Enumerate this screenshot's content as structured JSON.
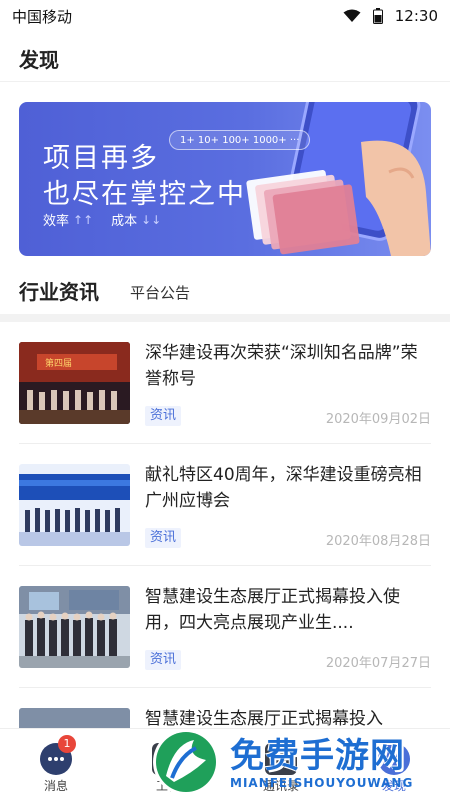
{
  "status_bar": {
    "carrier": "中国移动",
    "time": "12:30",
    "icons": [
      "wifi-icon",
      "battery-icon"
    ]
  },
  "header": {
    "title": "发现"
  },
  "banner": {
    "line1": "项目再多",
    "line2": "也尽在掌控之中",
    "metric_efficiency": "效率",
    "metric_cost": "成本",
    "pill_text": "1+  10+  100+  1000+  ···",
    "colors": {
      "start": "#4f60d6",
      "end": "#7b8ef0"
    }
  },
  "tabs": {
    "active": "行业资讯",
    "inactive": "平台公告"
  },
  "news": [
    {
      "title": "深华建设再次荣获“深圳知名品牌”荣誉称号",
      "tag": "资讯",
      "date": "2020年09月02日"
    },
    {
      "title": "献礼特区40周年，深华建设重磅亮相广州应博会",
      "tag": "资讯",
      "date": "2020年08月28日"
    },
    {
      "title": "智慧建设生态展厅正式揭幕投入使用，四大亮点展现产业生....",
      "tag": "资讯",
      "date": "2020年07月27日"
    },
    {
      "title": "智慧建设生态展厅正式揭幕投入",
      "tag": "",
      "date": ""
    }
  ],
  "tab_bar": {
    "items": [
      {
        "label": "消息",
        "icon": "chat-icon",
        "badge": "1"
      },
      {
        "label": "工作",
        "icon": "work-icon",
        "badge": ""
      },
      {
        "label": "通讯录",
        "icon": "contacts-icon",
        "badge": ""
      },
      {
        "label": "发现",
        "icon": "discover-icon",
        "badge": ""
      }
    ]
  },
  "watermark": {
    "title": "免费手游网",
    "subtitle": "MIANFEISHOUYOUWANG"
  },
  "accent_color": "#4a6fd8"
}
